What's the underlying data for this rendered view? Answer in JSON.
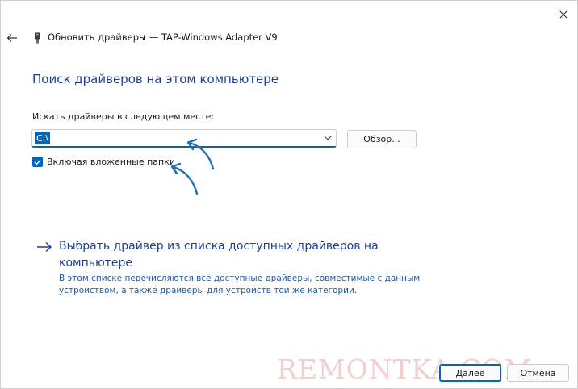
{
  "header": {
    "title": "Обновить драйверы — TAP-Windows Adapter V9"
  },
  "main": {
    "heading": "Поиск драйверов на этом компьютере",
    "search_location_label": "Искать драйверы в следующем месте:",
    "path_value": "C:\\",
    "browse_label": "Обзор...",
    "include_subfolders_label": "Включая вложенные папки",
    "include_subfolders_checked": true,
    "pick_link_title": "Выбрать драйвер из списка доступных драйверов на компьютере",
    "pick_link_description": "В этом списке перечисляются все доступные драйверы, совместимые с данным устройством, а также драйверы для устройств той же категории."
  },
  "watermark": "REMONTKA.COM",
  "footer": {
    "next_label": "Далее",
    "cancel_label": "Отмена"
  },
  "icons": {
    "close": "close-icon",
    "back": "back-arrow-icon",
    "device": "device-icon",
    "dropdown": "chevron-down-icon",
    "check": "checkmark-icon",
    "link_arrow": "arrow-right-icon"
  },
  "colors": {
    "accent": "#0067c0",
    "heading": "#1f3f8f",
    "annotation_arrow": "#1f6fb5",
    "watermark": "#f1cfcf"
  }
}
